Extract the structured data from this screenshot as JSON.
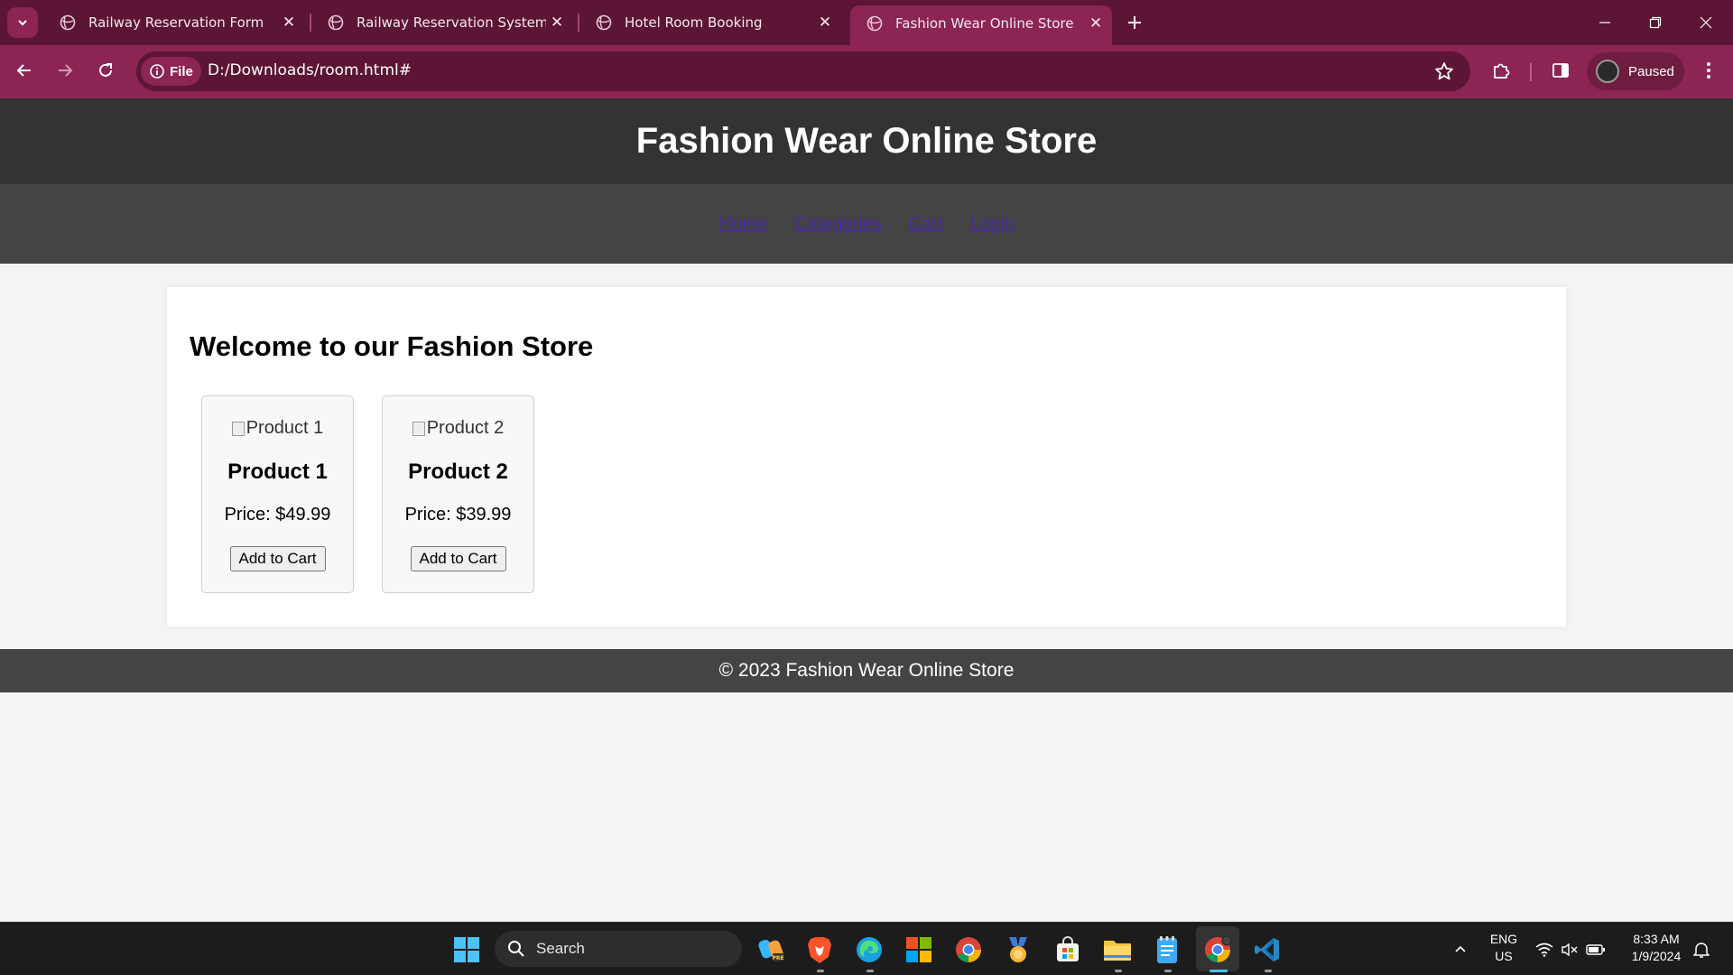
{
  "browser": {
    "tabs": [
      {
        "title": "Railway Reservation Form",
        "active": false
      },
      {
        "title": "Railway Reservation System",
        "active": false
      },
      {
        "title": "Hotel Room Booking",
        "active": false
      },
      {
        "title": "Fashion Wear Online Store",
        "active": true
      }
    ],
    "site_info_label": "File",
    "url": "D:/Downloads/room.html#",
    "profile_label": "Paused",
    "colors": {
      "frame": "#5c1534",
      "toolbar": "#8c2553"
    }
  },
  "site": {
    "title": "Fashion Wear Online Store",
    "nav": [
      "Home",
      "Categories",
      "Cart",
      "Login"
    ],
    "welcome": "Welcome to our Fashion Store",
    "products": [
      {
        "alt": "Product 1",
        "name": "Product 1",
        "price": "Price: $49.99",
        "button": "Add to Cart"
      },
      {
        "alt": "Product 2",
        "name": "Product 2",
        "price": "Price: $39.99",
        "button": "Add to Cart"
      }
    ],
    "footer": "© 2023 Fashion Wear Online Store"
  },
  "taskbar": {
    "search_label": "Search",
    "lang_top": "ENG",
    "lang_bottom": "US",
    "time": "8:33 AM",
    "date": "1/9/2024"
  }
}
